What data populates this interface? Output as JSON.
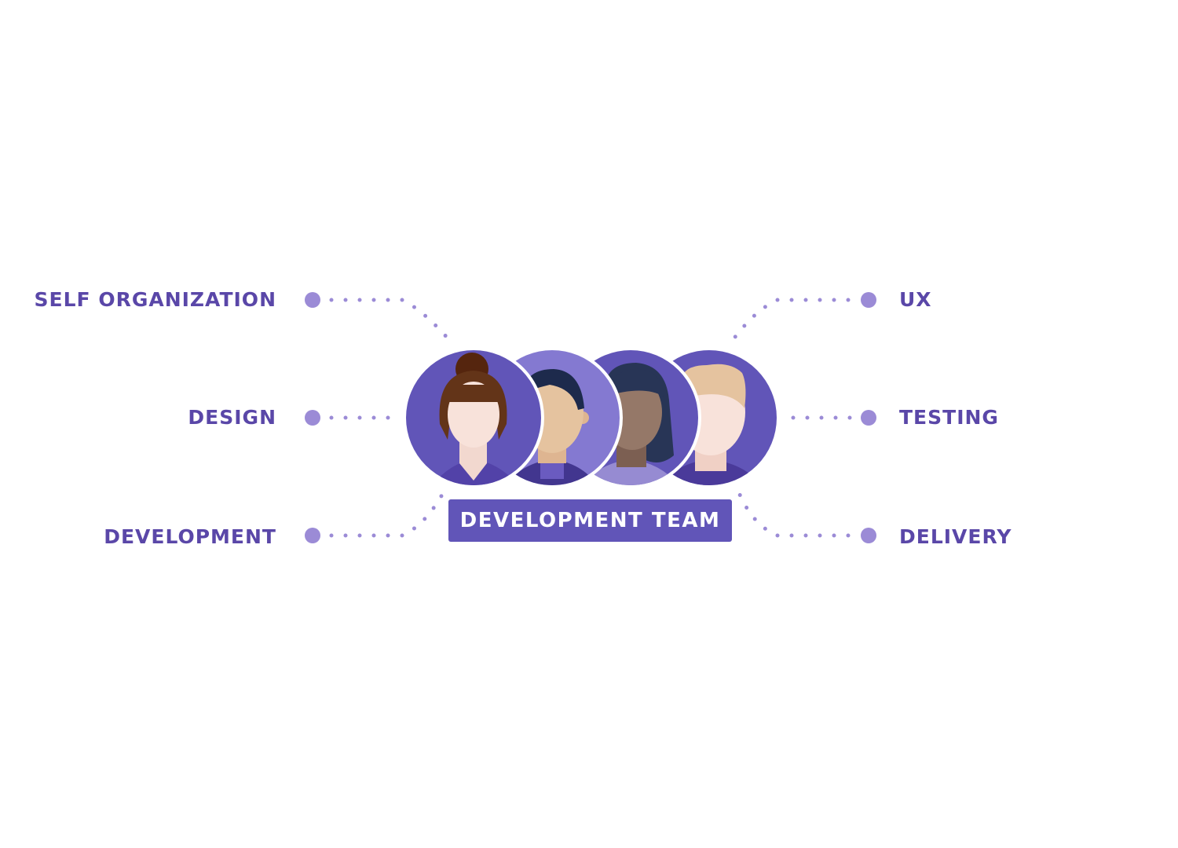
{
  "labels_left": [
    "SELF ORGANIZATION",
    "DESIGN",
    "DEVELOPMENT"
  ],
  "labels_right": [
    "UX",
    "TESTING",
    "DELIVERY"
  ],
  "team_label": "DEVELOPMENT TEAM",
  "colors": {
    "text": "#5a47a8",
    "dot": "#9b8bd6",
    "badge": "#6155b8",
    "circle": "#6155b8",
    "circle_light": "#8479d1"
  },
  "avatars": [
    "woman-brown-hair-bun",
    "man-dark-hair",
    "woman-long-dark-hair",
    "man-blond-hair"
  ]
}
